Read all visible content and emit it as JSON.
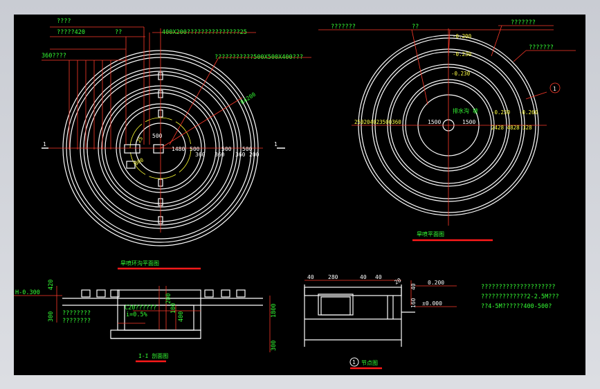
{
  "plan_left": {
    "title": "旱喷环沟平面图",
    "labels": {
      "l1": "????",
      "l2": "?????420",
      "l3": "??",
      "l4": "400X200???????????????25",
      "l5": "360????",
      "l6": "???????????500X500X400???",
      "radius": "R4200",
      "d500": "500",
      "d800": "800",
      "d25": "25",
      "d1480": "1480",
      "d500b": "500",
      "d360a": "360",
      "d500c": "500",
      "d360b": "360",
      "d500d": "500",
      "d360c": "360",
      "d200": "200",
      "section_left": "1",
      "section_right": "1"
    }
  },
  "plan_right": {
    "title": "旱喷平面图",
    "labels": {
      "r1": "???????",
      "r2": "??",
      "r3": "???????",
      "r4": "???????",
      "r_el1": "-0.200",
      "r_el2": "-0.230",
      "r_el3": "-0.230",
      "r_el4": "-0.230",
      "r_center": "排水沟 坡",
      "r_el5": "-0.260",
      "r_d1500a": "1500",
      "r_d1500b": "1500",
      "r_dims_left": "250204023500360",
      "r_dims_right": "2428 4828 328",
      "r_detail": "1"
    }
  },
  "section": {
    "title": "I-I 剖面图",
    "labels": {
      "h": "H-0.300",
      "d420": "420",
      "d300": "300",
      "c20": "C20??????",
      "slope": "i=0.5%",
      "n1": "????????",
      "n2": "????????",
      "d200": "200",
      "d100": "100",
      "d400": "400",
      "d1800": "1800",
      "d300b": "300"
    }
  },
  "detail": {
    "title": "节点图",
    "number": "1",
    "labels": {
      "d40a": "40",
      "d280": "280",
      "d40b": "40",
      "d40c": "40",
      "d20": "20",
      "d40d": "40",
      "el_top": "0.200",
      "el_zero": "±0.000",
      "d160": "160"
    }
  },
  "notes": {
    "line1": "?????????????????????",
    "line2": "?????????????2-2.5M???",
    "line3": "??4-5M??????400-500?"
  }
}
